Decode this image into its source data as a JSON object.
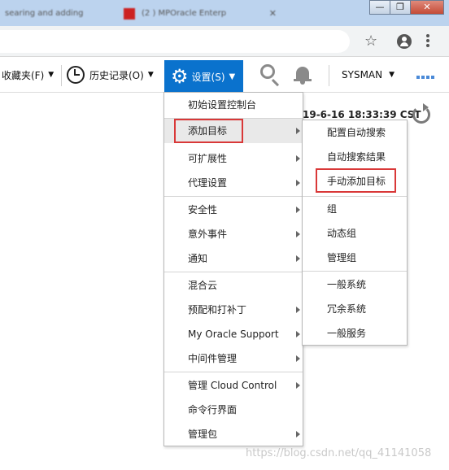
{
  "browser": {
    "tabs": [
      {
        "label": "searing and adding"
      },
      {
        "label": "(2 ) MPOracle Enterp"
      }
    ],
    "window_controls": {
      "minimize": "—",
      "restore": "❐",
      "close": "✕"
    }
  },
  "toolbar": {
    "favorites_label": "收藏夹(F)",
    "history_label": "历史记录(O)",
    "settings_label": "设置(S)",
    "user_label": "SYSMAN",
    "accent_color": "#0a72cd"
  },
  "page": {
    "timestamp": "19-6-16 18:33:39 CST",
    "watermark": "https://blog.csdn.net/qq_41141058"
  },
  "settings_menu": {
    "items": [
      {
        "label": "初始设置控制台",
        "submenu": false
      },
      {
        "label": "添加目标",
        "submenu": true,
        "highlighted": true
      },
      {
        "label": "可扩展性",
        "submenu": true
      },
      {
        "label": "代理设置",
        "submenu": true
      },
      {
        "label": "安全性",
        "submenu": true
      },
      {
        "label": "意外事件",
        "submenu": true
      },
      {
        "label": "通知",
        "submenu": true
      },
      {
        "label": "混合云",
        "submenu": false
      },
      {
        "label": "预配和打补丁",
        "submenu": true
      },
      {
        "label": "My Oracle Support",
        "submenu": true
      },
      {
        "label": "中间件管理",
        "submenu": true
      },
      {
        "label": "管理 Cloud Control",
        "submenu": true
      },
      {
        "label": "命令行界面",
        "submenu": false
      },
      {
        "label": "管理包",
        "submenu": true
      }
    ]
  },
  "add_target_submenu": {
    "items": [
      {
        "label": "配置自动搜索"
      },
      {
        "label": "自动搜索结果"
      },
      {
        "label": "手动添加目标",
        "boxed": true
      },
      {
        "label": "组"
      },
      {
        "label": "动态组"
      },
      {
        "label": "管理组"
      },
      {
        "label": "一般系统"
      },
      {
        "label": "冗余系统"
      },
      {
        "label": "一般服务"
      }
    ]
  }
}
